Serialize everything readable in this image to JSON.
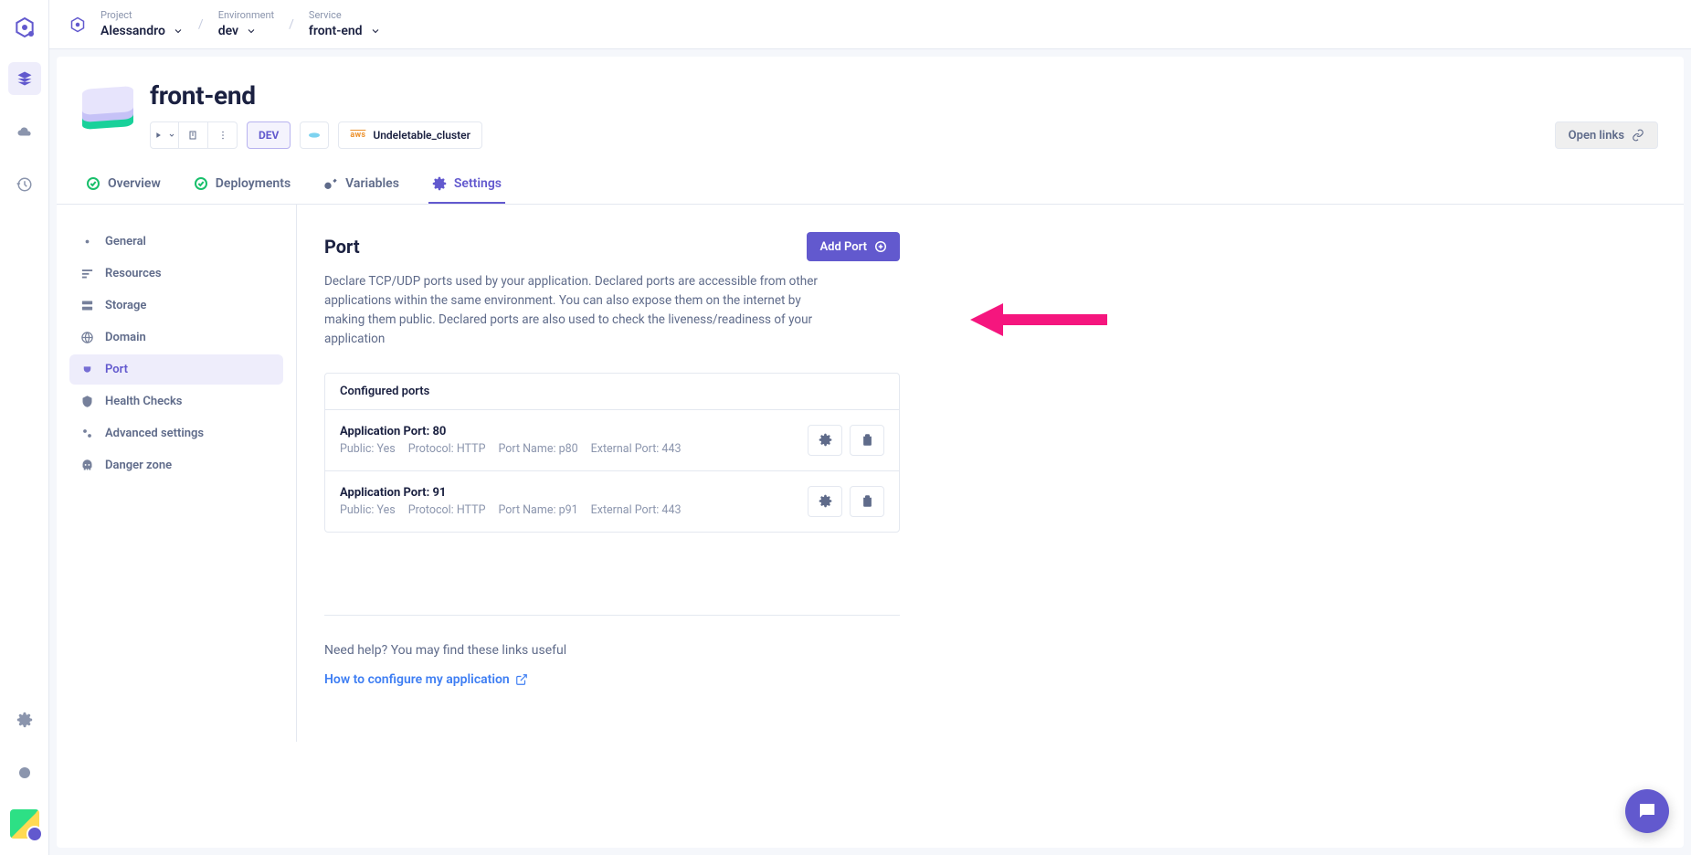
{
  "breadcrumb": {
    "project_label": "Project",
    "project_value": "Alessandro",
    "env_label": "Environment",
    "env_value": "dev",
    "service_label": "Service",
    "service_value": "front-end"
  },
  "service": {
    "title": "front-end",
    "env_badge": "DEV",
    "cluster": "Undeletable_cluster",
    "open_links": "Open links"
  },
  "tabs": {
    "overview": "Overview",
    "deployments": "Deployments",
    "variables": "Variables",
    "settings": "Settings"
  },
  "settings_nav": {
    "general": "General",
    "resources": "Resources",
    "storage": "Storage",
    "domain": "Domain",
    "port": "Port",
    "health": "Health Checks",
    "advanced": "Advanced settings",
    "danger": "Danger zone"
  },
  "port": {
    "heading": "Port",
    "add_btn": "Add Port",
    "description": "Declare TCP/UDP ports used by your application. Declared ports are accessible from other applications within the same environment. You can also expose them on the internet by making them public. Declared ports are also used to check the liveness/readiness of your application",
    "panel_title": "Configured ports",
    "rows": [
      {
        "title": "Application Port: 80",
        "public": "Public: Yes",
        "protocol": "Protocol: HTTP",
        "name": "Port Name: p80",
        "external": "External Port: 443"
      },
      {
        "title": "Application Port: 91",
        "public": "Public: Yes",
        "protocol": "Protocol: HTTP",
        "name": "Port Name: p91",
        "external": "External Port: 443"
      }
    ]
  },
  "help": {
    "question": "Need help? You may find these links useful",
    "link": "How to configure my application"
  }
}
